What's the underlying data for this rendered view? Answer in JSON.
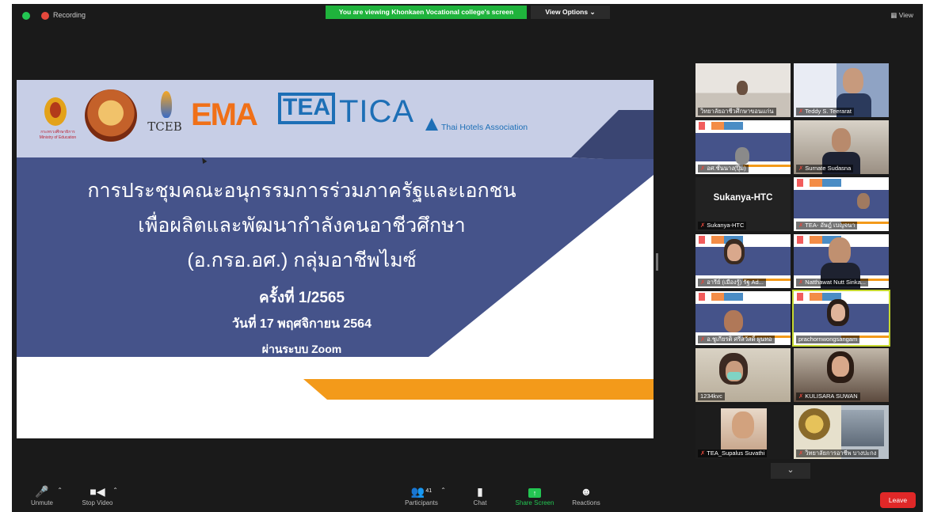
{
  "top_bar": {
    "recording_label": "Recording",
    "share_banner": "You are viewing Khonkaen Vocational college's screen",
    "view_options": "View Options ⌄",
    "view_toggle": "▦ View"
  },
  "slide": {
    "logos": {
      "moe_text": "กระทรวงศึกษาธิการ Ministry of Education",
      "tceb": "TCEB",
      "ema": "EMA",
      "tea": "TEA",
      "tica": "TICA",
      "tha": "Thai Hotels Association"
    },
    "line1": "การประชุมคณะอนุกรรมการร่วมภาครัฐและเอกชน",
    "line2": "เพื่อผลิตและพัฒนากำลังคนอาชีวศึกษา",
    "line3": "(อ.กรอ.อศ.) กลุ่มอาชีพไมซ์",
    "line4": "ครั้งที่ 1/2565",
    "line5": "วันที่ 17 พฤศจิกายน 2564",
    "line6": "ผ่านระบบ  Zoom",
    "colors": {
      "band": "#45538a",
      "accent": "#f39a1a",
      "light_band": "#c7cee6"
    }
  },
  "gallery": {
    "tiles": [
      {
        "name": "วิทยาลัยอาชีวศึกษาขอนแก่น",
        "muted": false
      },
      {
        "name": "Teddy S. Teerarat",
        "muted": true
      },
      {
        "name": "อศ.ชั้นนาง(ปุ๊ม)",
        "muted": true
      },
      {
        "name": "Surnate Sudasna",
        "muted": true
      },
      {
        "name": "Sukanya-HTC",
        "muted": true,
        "display": "Sukanya-HTC"
      },
      {
        "name": "TEA- อัษฎ์ เบญจนา",
        "muted": true
      },
      {
        "name": "อารีย์ (เมืองรู้) รัฐ Ad...",
        "muted": true
      },
      {
        "name": "Natthawat Nutt Sinka...",
        "muted": true
      },
      {
        "name": "อ.ชูเกียรติ ศรีสวัสดิ์ ผูนทอ",
        "muted": true
      },
      {
        "name": "prachornwongsangam",
        "muted": false
      },
      {
        "name": "1234kvc",
        "muted": false
      },
      {
        "name": "KULISARA SUWAN",
        "muted": true
      },
      {
        "name": "TEA_Supalus Suvathi",
        "muted": true
      },
      {
        "name": "วิทยาลัยการอาชีพ บางปะกง",
        "muted": true
      }
    ],
    "scroll_more": "⌄"
  },
  "toolbar": {
    "unmute": "Unmute",
    "stop_video": "Stop Video",
    "participants": "Participants",
    "participants_count": "41",
    "chat": "Chat",
    "share_screen": "Share Screen",
    "reactions": "Reactions",
    "leave": "Leave"
  }
}
